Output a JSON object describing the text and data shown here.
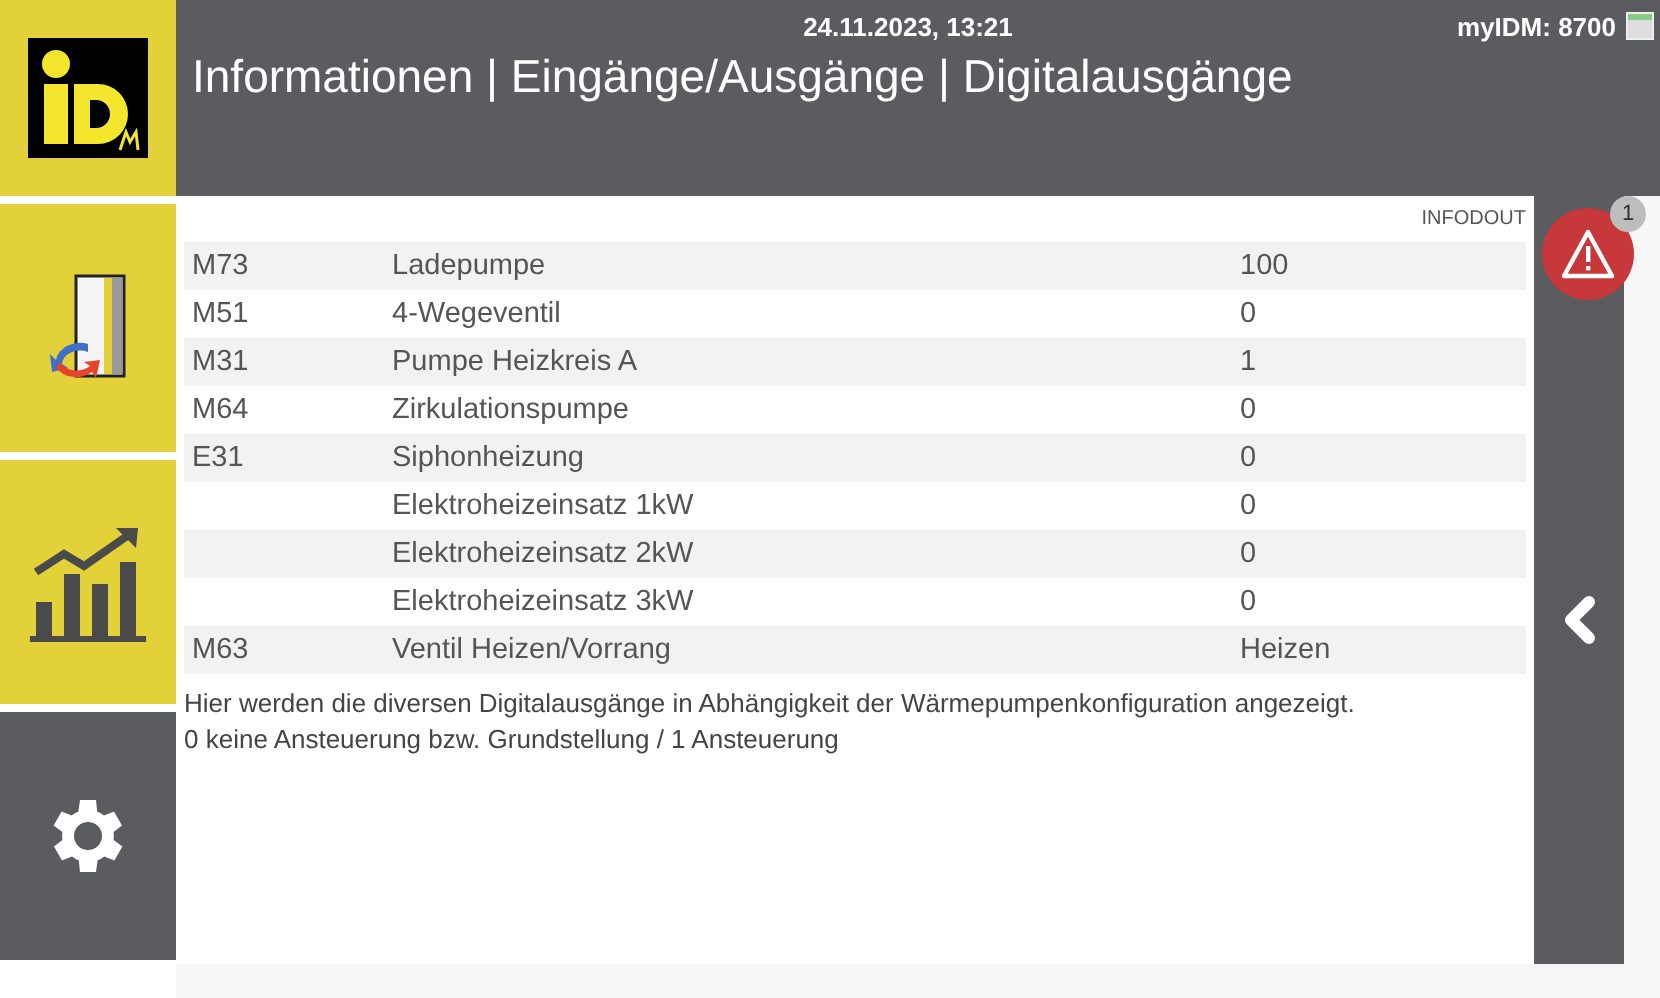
{
  "header": {
    "datetime": "24.11.2023, 13:21",
    "device": "myIDM: 8700",
    "title": "Informationen | Eingänge/Ausgänge | Digitalausgänge"
  },
  "sidebar": {
    "items": [
      {
        "kind": "io",
        "highlighted": true
      },
      {
        "kind": "chart",
        "highlighted": true
      },
      {
        "kind": "settings",
        "highlighted": false
      }
    ]
  },
  "alert": {
    "count": "1"
  },
  "table": {
    "code": "INFODOUT",
    "rows": [
      {
        "id": "M73",
        "name": "Ladepumpe",
        "value": "100"
      },
      {
        "id": "M51",
        "name": "4-Wegeventil",
        "value": "0"
      },
      {
        "id": "M31",
        "name": "Pumpe Heizkreis A",
        "value": "1"
      },
      {
        "id": "M64",
        "name": "Zirkulationspumpe",
        "value": "0"
      },
      {
        "id": "E31",
        "name": "Siphonheizung",
        "value": "0"
      },
      {
        "name": "Elektroheizeinsatz 1kW",
        "value": "0"
      },
      {
        "name": "Elektroheizeinsatz 2kW",
        "value": "0"
      },
      {
        "name": "Elektroheizeinsatz 3kW",
        "value": "0"
      },
      {
        "id": "M63",
        "name": "Ventil Heizen/Vorrang",
        "value": "Heizen"
      }
    ]
  },
  "description": [
    "Hier werden die diversen Digitalausgänge in Abhängigkeit der Wärmepumpenkonfiguration angezeigt.",
    "0 keine Ansteuerung bzw. Grundstellung / 1 Ansteuerung"
  ]
}
